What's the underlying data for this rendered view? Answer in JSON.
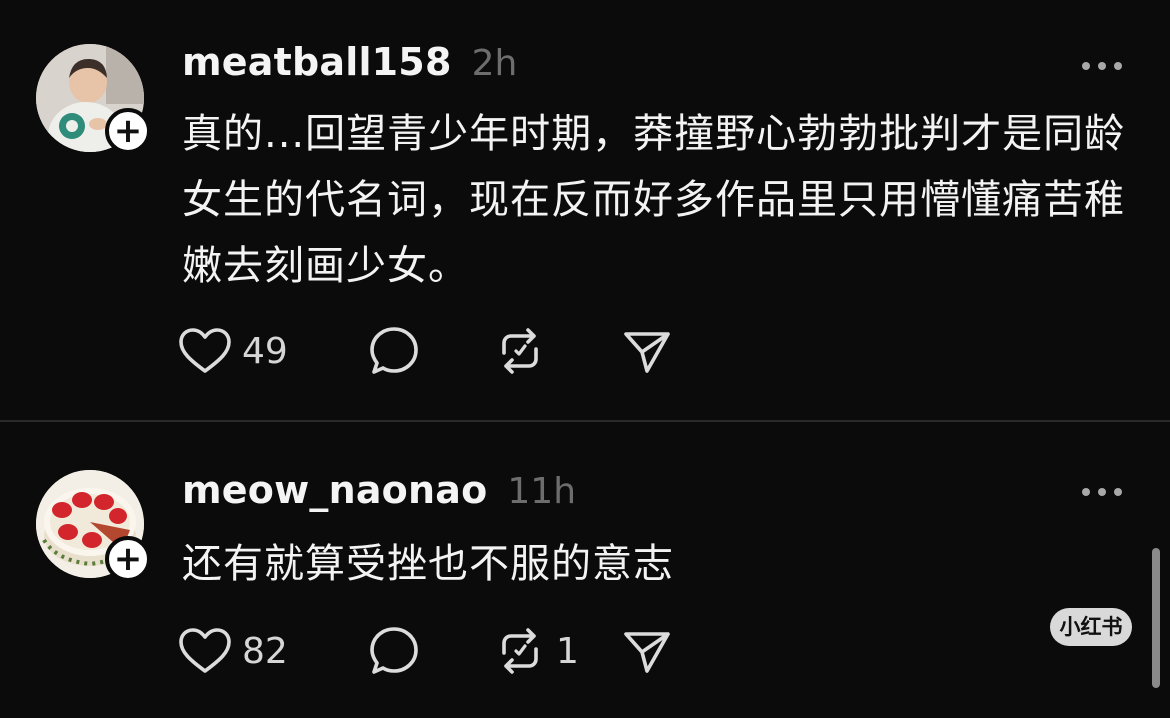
{
  "posts": [
    {
      "username": "meatball158",
      "timestamp": "2h",
      "avatar": "toddler-photo-avatar",
      "body": "真的...回望青少年时期，莽撞野心勃勃批判才是同龄女生的代名词，现在反而好多作品里只用懵懂痛苦稚嫩去刻画少女。",
      "likes": "49",
      "reposts": ""
    },
    {
      "username": "meow_naonao",
      "timestamp": "11h",
      "avatar": "strawberry-cake-avatar",
      "body": "还有就算受挫也不服的意志",
      "likes": "82",
      "reposts": "1"
    }
  ],
  "watermark": "小红书",
  "icons": {
    "like": "heart-icon",
    "comment": "comment-bubble-icon",
    "repost": "repost-icon",
    "share": "send-icon",
    "more": "more-dots-icon",
    "follow": "plus-icon"
  },
  "colors": {
    "background": "#0b0b0b",
    "text": "#f3f3f3",
    "muted": "#6d6d6d",
    "icon": "#dcdcdc"
  }
}
